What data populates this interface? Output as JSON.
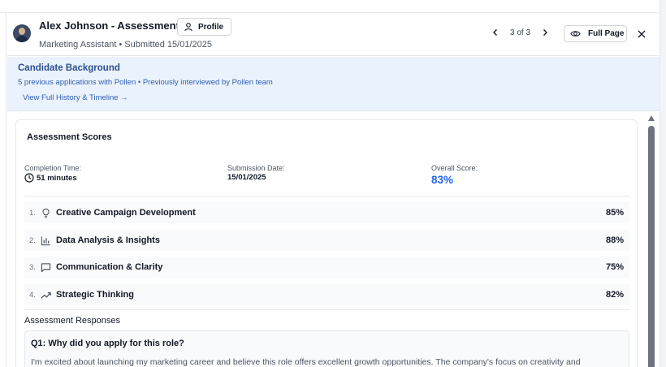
{
  "header": {
    "title": "Alex Johnson - Assessment",
    "profile_button": "Profile",
    "subtitle": "Marketing Assistant • Submitted 15/01/2025",
    "pager": "3 of 3",
    "full_page_button": "Full Page"
  },
  "background": {
    "title": "Candidate Background",
    "summary": "5 previous applications with Pollen • Previously interviewed by Pollen team",
    "link": "View Full History & Timeline →"
  },
  "scores": {
    "title": "Assessment Scores",
    "completion_label": "Completion Time:",
    "completion_value": "51 minutes",
    "submission_label": "Submission Date:",
    "submission_value": "15/01/2025",
    "overall_label": "Overall Score:",
    "overall_value": "83%",
    "accent_color": "#2563eb",
    "skills": [
      {
        "num": "1.",
        "icon": "lightbulb-icon",
        "name": "Creative Campaign Development",
        "score": "85%"
      },
      {
        "num": "2.",
        "icon": "bar-chart-icon",
        "name": "Data Analysis & Insights",
        "score": "88%"
      },
      {
        "num": "3.",
        "icon": "message-icon",
        "name": "Communication & Clarity",
        "score": "75%"
      },
      {
        "num": "4.",
        "icon": "trending-up-icon",
        "name": "Strategic Thinking",
        "score": "82%"
      }
    ]
  },
  "responses": {
    "title": "Assessment Responses",
    "items": [
      {
        "question": "Q1: Why did you apply for this role?",
        "answer": "I'm excited about launching my marketing career and believe this role offers excellent growth opportunities. The company's focus on creativity and"
      }
    ]
  }
}
